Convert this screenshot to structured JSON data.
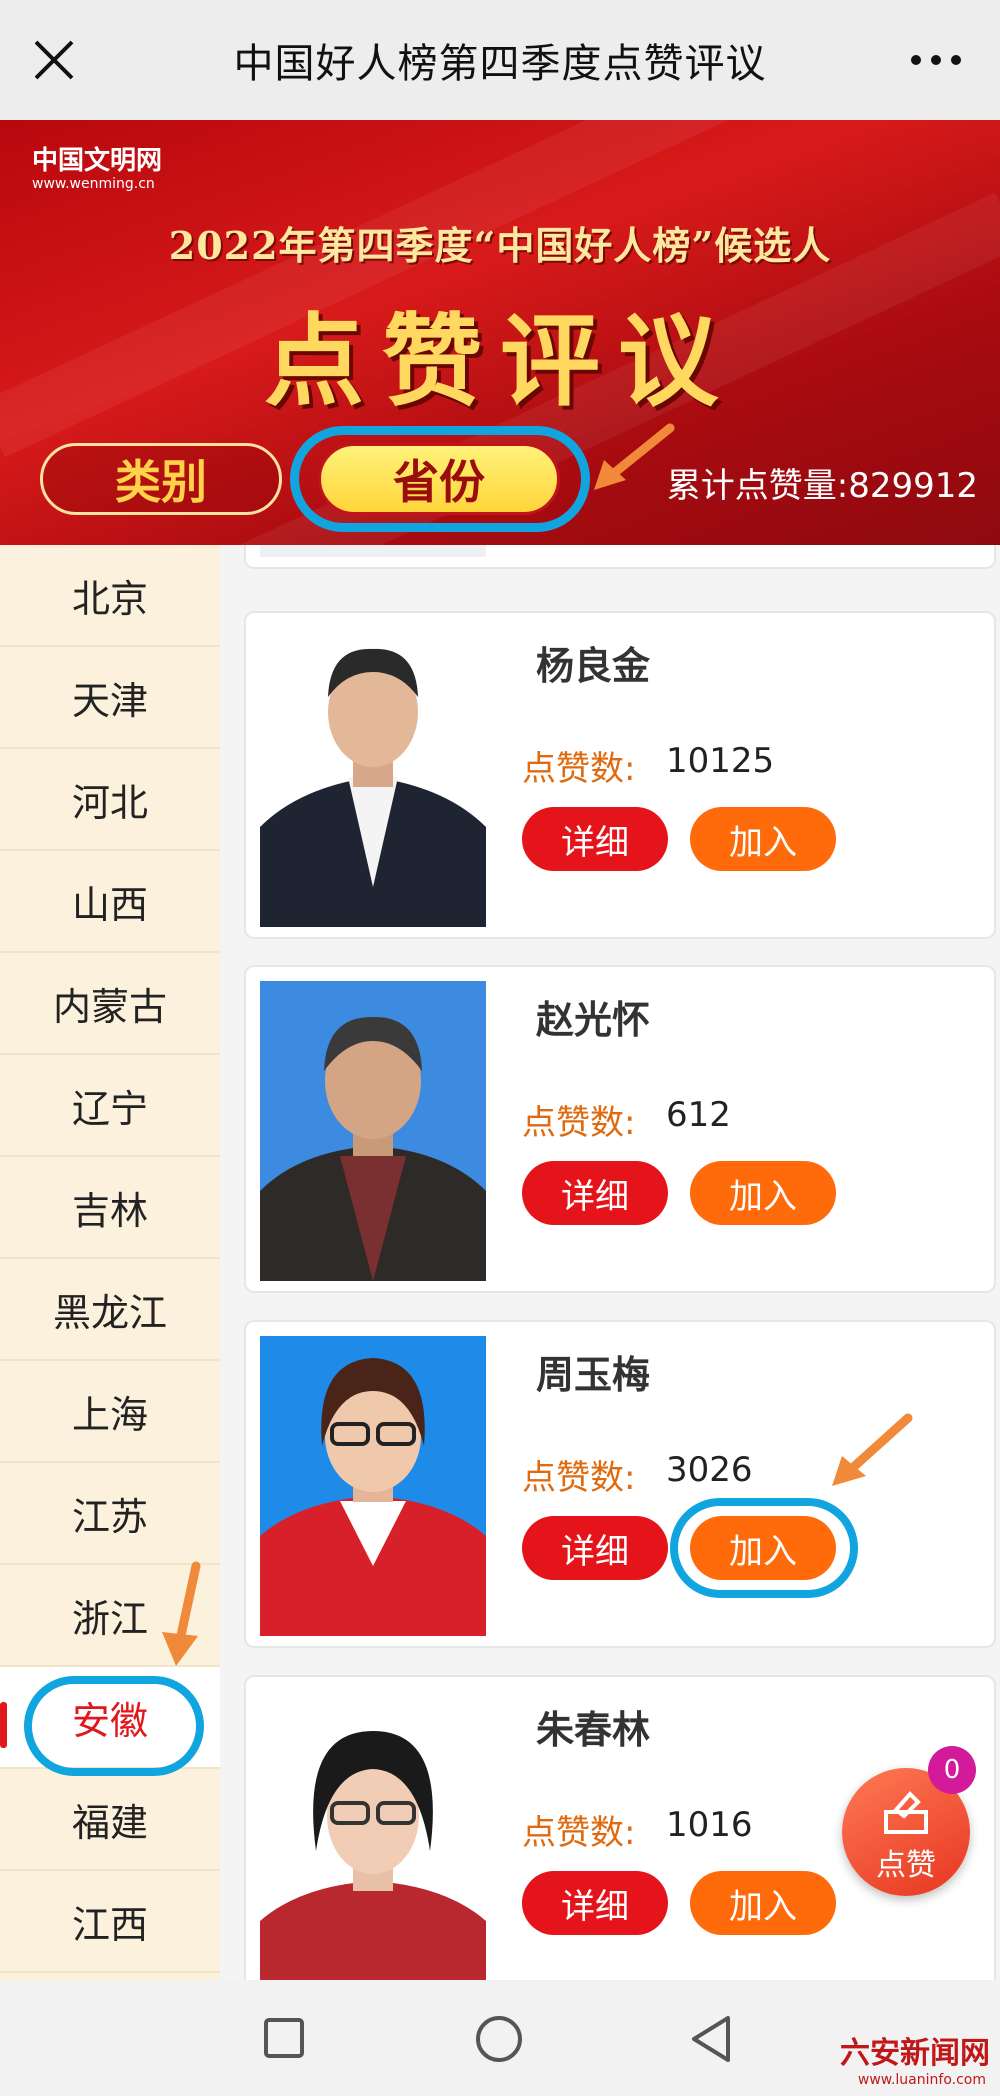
{
  "topbar": {
    "title": "中国好人榜第四季度点赞评议"
  },
  "banner": {
    "logo_cn": "中国文明网",
    "logo_url": "www.wenming.cn",
    "heading": "2022年第四季度“中国好人榜”候选人",
    "big_title": "点赞评议",
    "tab_category": "类别",
    "tab_province": "省份",
    "total_label": "累计点赞量:829912"
  },
  "sidebar": {
    "items": [
      {
        "label": "北京"
      },
      {
        "label": "天津"
      },
      {
        "label": "河北"
      },
      {
        "label": "山西"
      },
      {
        "label": "内蒙古"
      },
      {
        "label": "辽宁"
      },
      {
        "label": "吉林"
      },
      {
        "label": "黑龙江"
      },
      {
        "label": "上海"
      },
      {
        "label": "江苏"
      },
      {
        "label": "浙江"
      },
      {
        "label": "安徽"
      },
      {
        "label": "福建"
      },
      {
        "label": "江西"
      }
    ],
    "active": "安徽"
  },
  "cards": [
    {
      "name": "杨良金",
      "likes_label": "点赞数:",
      "likes": "10125",
      "detail": "详细",
      "join": "加入",
      "bg": "#ffffff"
    },
    {
      "name": "赵光怀",
      "likes_label": "点赞数:",
      "likes": "612",
      "detail": "详细",
      "join": "加入",
      "bg": "#3d8be0"
    },
    {
      "name": "周玉梅",
      "likes_label": "点赞数:",
      "likes": "3026",
      "detail": "详细",
      "join": "加入",
      "bg": "#1f8be8"
    },
    {
      "name": "朱春林",
      "likes_label": "点赞数:",
      "likes": "1016",
      "detail": "详细",
      "join": "加入",
      "bg": "#ffffff"
    }
  ],
  "float_like": {
    "label": "点赞",
    "badge": "0"
  },
  "watermark": {
    "text": "六安新闻网",
    "url": "www.luaninfo.com"
  },
  "colors": {
    "accent_red": "#e5141a",
    "join_orange": "#ff6a0a",
    "highlight_ring": "#11a5e0"
  }
}
